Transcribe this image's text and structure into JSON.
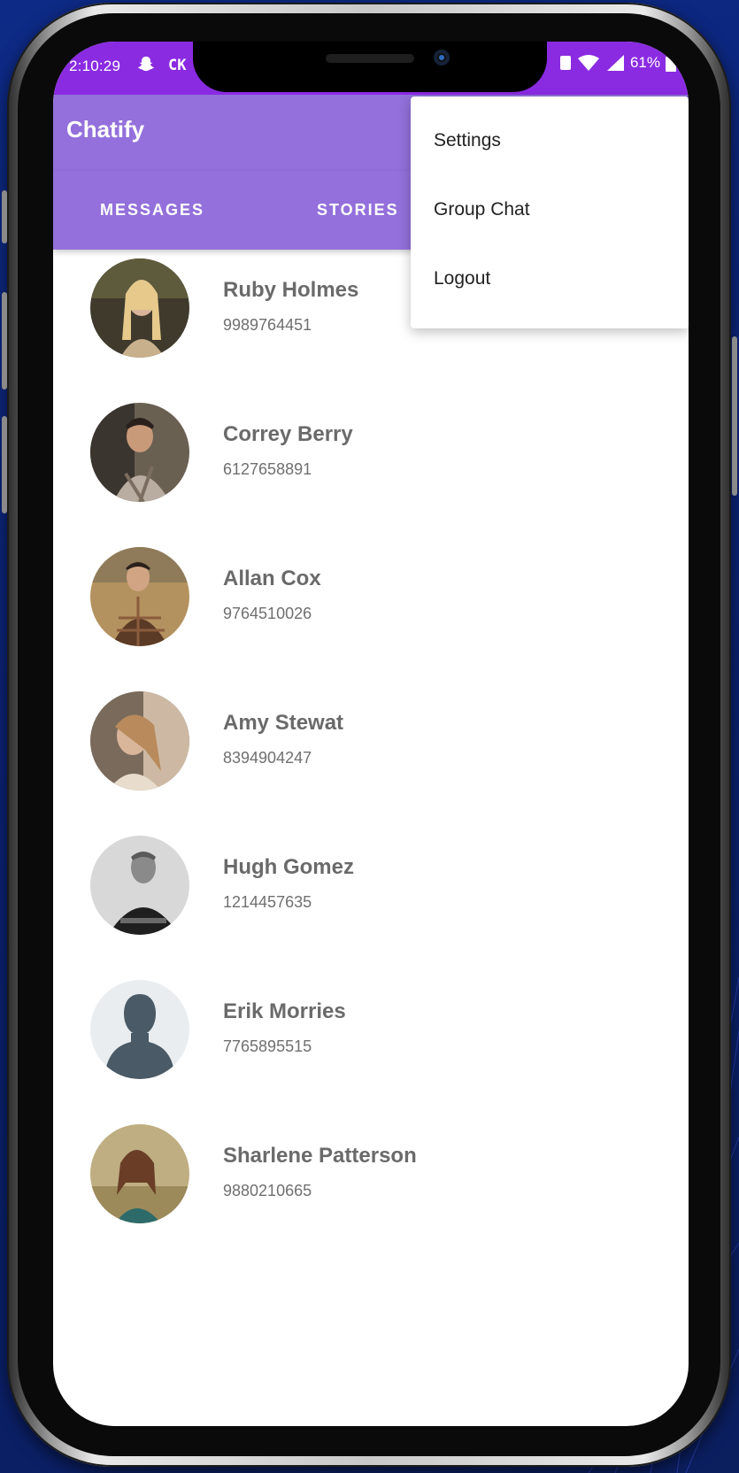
{
  "status_bar": {
    "time": "2:10:29",
    "carrier_tag": "CK",
    "battery": "61%",
    "icons": [
      "snapchat-ghost-icon",
      "notification-icon",
      "wifi-icon",
      "signal-icon",
      "battery-icon"
    ]
  },
  "app": {
    "title": "Chatify",
    "accent_color": "#9370db",
    "status_color": "#8a2be2"
  },
  "tabs": [
    {
      "label": "MESSAGES"
    },
    {
      "label": "STORIES"
    }
  ],
  "menu": {
    "items": [
      {
        "label": "Settings"
      },
      {
        "label": "Group Chat"
      },
      {
        "label": "Logout"
      }
    ]
  },
  "contacts": [
    {
      "name": "Ruby Holmes",
      "phone": "9989764451",
      "avatar": "photo"
    },
    {
      "name": "Correy Berry",
      "phone": "6127658891",
      "avatar": "photo"
    },
    {
      "name": "Allan Cox",
      "phone": "9764510026",
      "avatar": "photo"
    },
    {
      "name": "Amy Stewat",
      "phone": "8394904247",
      "avatar": "photo"
    },
    {
      "name": "Hugh Gomez",
      "phone": "1214457635",
      "avatar": "photo"
    },
    {
      "name": "Erik Morries",
      "phone": "7765895515",
      "avatar": "default-silhouette"
    },
    {
      "name": "Sharlene Patterson",
      "phone": "9880210665",
      "avatar": "photo"
    }
  ]
}
